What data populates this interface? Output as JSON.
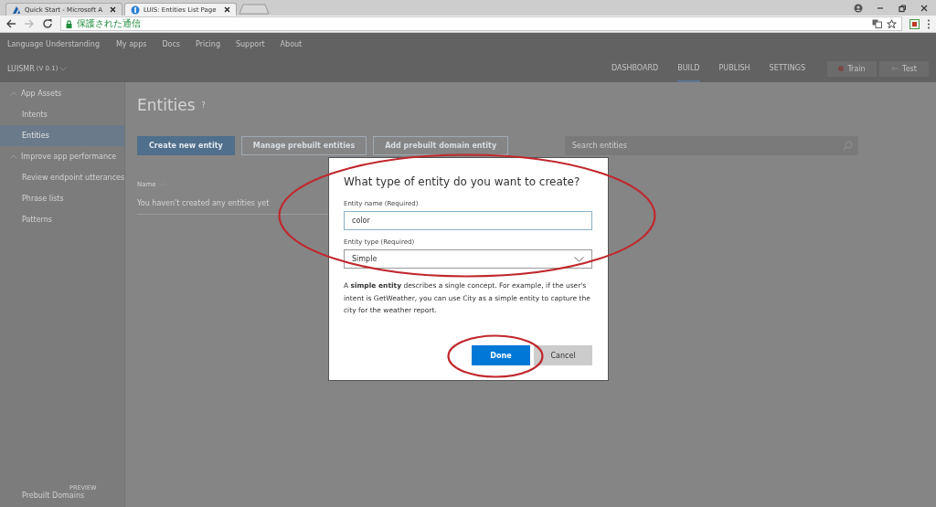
{
  "browser": {
    "tabs": [
      {
        "title": "Quick Start - Microsoft A",
        "selected": false
      },
      {
        "title": "LUIS: Entities List Page",
        "selected": true
      }
    ],
    "address": "保護された通信"
  },
  "top_nav": {
    "brand": "Language Understanding",
    "links": [
      "My apps",
      "Docs",
      "Pricing",
      "Support",
      "About"
    ]
  },
  "app_bar": {
    "app_name": "LUISMR",
    "version": "(V 0.1)",
    "tabs": [
      {
        "label": "DASHBOARD",
        "selected": false
      },
      {
        "label": "BUILD",
        "selected": true
      },
      {
        "label": "PUBLISH",
        "selected": false
      },
      {
        "label": "SETTINGS",
        "selected": false
      }
    ],
    "buttons": [
      {
        "label": "Train",
        "kind": "train"
      },
      {
        "label": "Test",
        "kind": "test"
      }
    ]
  },
  "sidebar": {
    "sections": [
      {
        "label": "App Assets",
        "expanded": true,
        "items": [
          {
            "label": "Intents",
            "selected": false
          },
          {
            "label": "Entities",
            "selected": true
          }
        ]
      },
      {
        "label": "Improve app performance",
        "expanded": true,
        "items": [
          {
            "label": "Review endpoint utterances",
            "selected": false
          },
          {
            "label": "Phrase lists",
            "selected": false
          },
          {
            "label": "Patterns",
            "selected": false
          }
        ]
      }
    ],
    "footer": {
      "label": "Prebuilt Domains",
      "badge": "PREVIEW"
    }
  },
  "content": {
    "title": "Entities",
    "help": "?",
    "buttons": [
      {
        "label": "Create new entity",
        "kind": "primary"
      },
      {
        "label": "Manage prebuilt entities",
        "kind": "outline"
      },
      {
        "label": "Add prebuilt domain entity",
        "kind": "outline"
      }
    ],
    "search": {
      "placeholder": "Search entities"
    },
    "table": {
      "columns": [
        "Name"
      ],
      "empty_text": "You haven't created any entities yet"
    }
  },
  "dialog": {
    "title": "What type of entity do you want to create?",
    "fields": [
      {
        "kind": "text",
        "label": "Entity name",
        "note": "(Required)",
        "value": "color"
      },
      {
        "kind": "select",
        "label": "Entity type",
        "note": "(Required)",
        "value": "Simple"
      }
    ],
    "description": "A **simple entity** describes a single concept. For example, if the user's intent is GetWeather, you can use City as a simple entity to capture the city for the weather report.",
    "buttons": [
      {
        "label": "Done",
        "kind": "primary"
      },
      {
        "label": "Cancel",
        "kind": "secondary"
      }
    ]
  },
  "annotations": [
    {
      "kind": "ellipse"
    },
    {
      "kind": "ellipse"
    }
  ]
}
